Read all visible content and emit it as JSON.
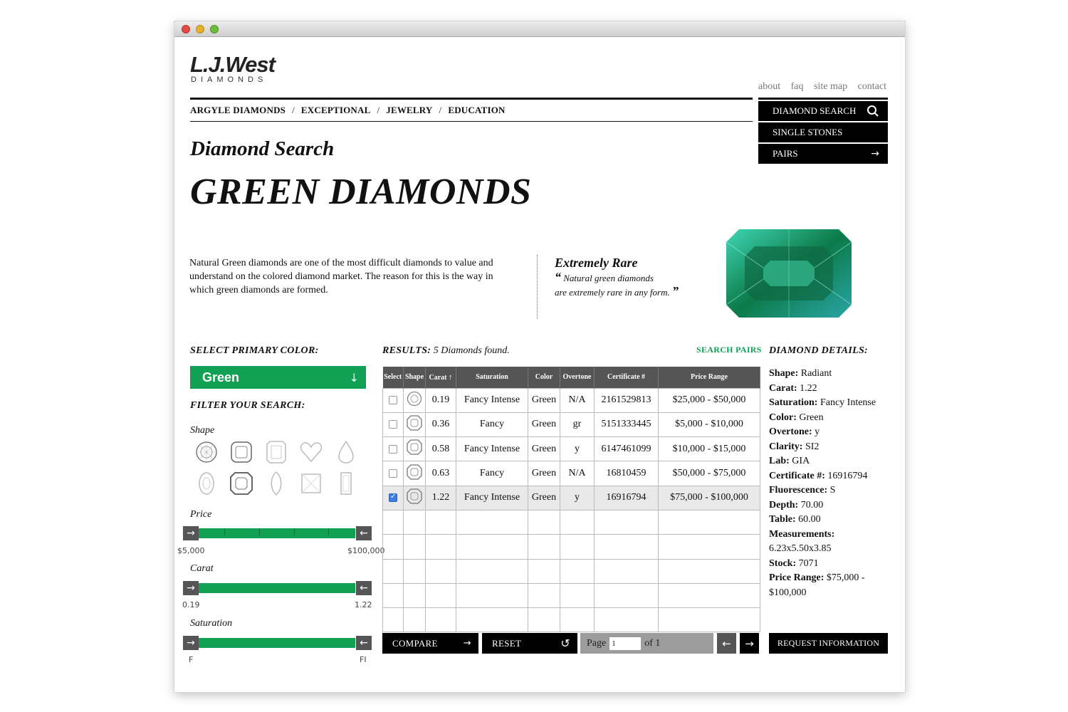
{
  "brand": {
    "logo_main": "L.J.West",
    "logo_sub": "DIAMONDS"
  },
  "utility_nav": [
    "about",
    "faq",
    "site map",
    "contact"
  ],
  "main_nav": [
    "ARGYLE DIAMONDS",
    "EXCEPTIONAL",
    "JEWELRY",
    "EDUCATION"
  ],
  "side_nav": {
    "diamond_search": "DIAMOND SEARCH",
    "single_stones": "SINGLE STONES",
    "pairs": "PAIRS"
  },
  "page": {
    "section": "Diamond Search",
    "title": "GREEN DIAMONDS"
  },
  "intro": "Natural Green diamonds are one of the most difficult diamonds to value and understand on the colored diamond market. The reason for this is the way in which green diamonds are formed.",
  "quote": {
    "title": "Extremely Rare",
    "line1": "Natural green diamonds",
    "line2": "are extremely rare in any form."
  },
  "filters": {
    "primary_color_label": "SELECT PRIMARY COLOR:",
    "primary_color_value": "Green",
    "filter_label": "FILTER YOUR SEARCH:",
    "shape_label": "Shape",
    "price": {
      "label": "Price",
      "min": "$5,000",
      "max": "$100,000"
    },
    "carat": {
      "label": "Carat",
      "min": "0.19",
      "max": "1.22"
    },
    "saturation": {
      "label": "Saturation",
      "min": "F",
      "max": "FI"
    }
  },
  "results": {
    "label": "RESULTS:",
    "count_text": "5 Diamonds found.",
    "search_pairs": "SEARCH PAIRS",
    "columns": [
      "Select",
      "Shape",
      "Carat",
      "Saturation",
      "Color",
      "Overtone",
      "Certificate #",
      "Price Range"
    ],
    "sort_indicator": "↑",
    "rows": [
      {
        "carat": "0.19",
        "saturation": "Fancy Intense",
        "color": "Green",
        "overtone": "N/A",
        "certificate": "2161529813",
        "price": "$25,000 - $50,000",
        "selected": false
      },
      {
        "carat": "0.36",
        "saturation": "Fancy",
        "color": "Green",
        "overtone": "gr",
        "certificate": "5151333445",
        "price": "$5,000 - $10,000",
        "selected": false
      },
      {
        "carat": "0.58",
        "saturation": "Fancy Intense",
        "color": "Green",
        "overtone": "y",
        "certificate": "6147461099",
        "price": "$10,000 - $15,000",
        "selected": false
      },
      {
        "carat": "0.63",
        "saturation": "Fancy",
        "color": "Green",
        "overtone": "N/A",
        "certificate": "16810459",
        "price": "$50,000 - $75,000",
        "selected": false
      },
      {
        "carat": "1.22",
        "saturation": "Fancy Intense",
        "color": "Green",
        "overtone": "y",
        "certificate": "16916794",
        "price": "$75,000 - $100,000",
        "selected": true
      }
    ],
    "compare": "COMPARE",
    "reset": "RESET",
    "page_label": "Page",
    "page_value": "1",
    "page_of": "of 1"
  },
  "details": {
    "heading": "DIAMOND DETAILS:",
    "rows": [
      {
        "k": "Shape:",
        "v": "Radiant"
      },
      {
        "k": "Carat:",
        "v": "1.22"
      },
      {
        "k": "Saturation:",
        "v": "Fancy Intense"
      },
      {
        "k": "Color:",
        "v": "Green"
      },
      {
        "k": "Overtone:",
        "v": "y"
      },
      {
        "k": "Clarity:",
        "v": "SI2"
      },
      {
        "k": "Lab:",
        "v": "GIA"
      },
      {
        "k": "Certificate #:",
        "v": "16916794"
      },
      {
        "k": "Fluorescence:",
        "v": "S"
      },
      {
        "k": "Depth:",
        "v": "70.00"
      },
      {
        "k": "Table:",
        "v": "60.00"
      },
      {
        "k": "Measurements:",
        "v": "6.23x5.50x3.85"
      },
      {
        "k": "Stock:",
        "v": "7071"
      },
      {
        "k": "Price Range:",
        "v": "$75,000 - $100,000"
      }
    ],
    "request": "REQUEST INFORMATION"
  },
  "colors": {
    "accent_green": "#12a054",
    "nav_black": "#000000",
    "handle_gray": "#555555"
  }
}
